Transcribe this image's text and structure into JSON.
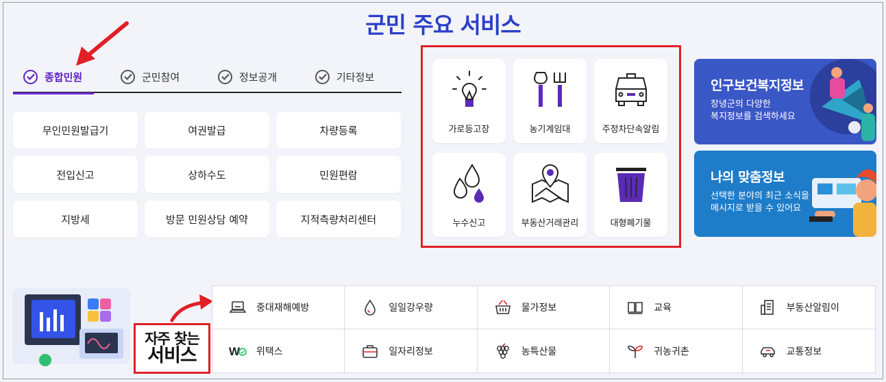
{
  "title": "군민 주요 서비스",
  "tabs": [
    {
      "label": "종합민원",
      "active": true
    },
    {
      "label": "군민참여",
      "active": false
    },
    {
      "label": "정보공개",
      "active": false
    },
    {
      "label": "기타정보",
      "active": false
    }
  ],
  "services": [
    "무인민원발급기",
    "여권발급",
    "차량등록",
    "전입신고",
    "상하수도",
    "민원편람",
    "지방세",
    "방문 민원상담 예약",
    "지적측량처리센터"
  ],
  "featured": [
    {
      "label": "가로등고장",
      "icon": "lightbulb-icon"
    },
    {
      "label": "농기계임대",
      "icon": "farm-tools-icon"
    },
    {
      "label": "주정차단속알림",
      "icon": "car-icon"
    },
    {
      "label": "누수신고",
      "icon": "water-drops-icon"
    },
    {
      "label": "부동산거래관리",
      "icon": "map-pin-icon"
    },
    {
      "label": "대형폐기물",
      "icon": "trash-bin-icon"
    }
  ],
  "banners": [
    {
      "title": "인구보건복지정보",
      "sub1": "창녕군의 다양한",
      "sub2": "복지정보를 검색하세요"
    },
    {
      "title": "나의 맞춤정보",
      "sub1": "선택한 분야의 최근 소식을",
      "sub2": "메시지로 받을 수 있어요"
    }
  ],
  "frequent": {
    "label_line1": "자주 찾는",
    "label_line2": "서비스",
    "items": [
      {
        "label": "중대재해예방",
        "icon": "laptop-icon"
      },
      {
        "label": "일일강우량",
        "icon": "raindrop-icon"
      },
      {
        "label": "물가정보",
        "icon": "basket-icon"
      },
      {
        "label": "교육",
        "icon": "book-icon"
      },
      {
        "label": "부동산알림이",
        "icon": "building-icon"
      },
      {
        "label": "위택스",
        "icon": "wetax-icon",
        "logo_text": "W"
      },
      {
        "label": "일자리정보",
        "icon": "briefcase-icon"
      },
      {
        "label": "농특산물",
        "icon": "grapes-icon"
      },
      {
        "label": "귀농귀촌",
        "icon": "sprout-icon"
      },
      {
        "label": "교통정보",
        "icon": "car-outline-icon"
      }
    ]
  },
  "colors": {
    "accent": "#5b1fc4",
    "title": "#2b3fc8",
    "highlight": "#e01f26",
    "banner1": "#3a57c6",
    "banner2": "#1e7cc8"
  }
}
